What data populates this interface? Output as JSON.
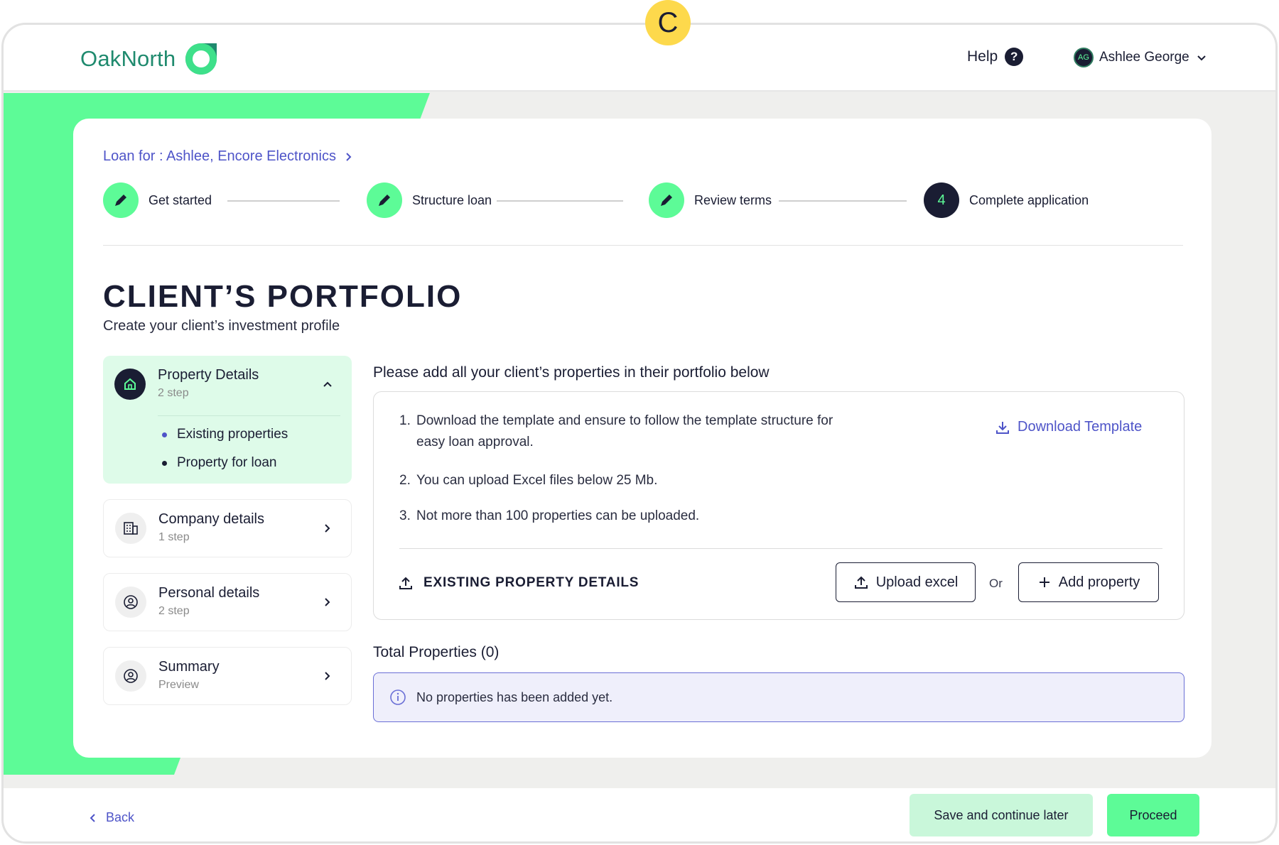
{
  "marker": "C",
  "header": {
    "logo_text": "OakNorth",
    "help_label": "Help",
    "help_badge": "?",
    "user_initials": "AG",
    "user_name": "Ashlee George"
  },
  "breadcrumb": "Loan for : Ashlee, Encore Electronics",
  "steps": [
    {
      "label": "Get started",
      "state": "done"
    },
    {
      "label": "Structure loan",
      "state": "done"
    },
    {
      "label": "Review terms",
      "state": "done"
    },
    {
      "label": "Complete application",
      "state": "active",
      "number": "4"
    }
  ],
  "page": {
    "title": "CLIENT’S PORTFOLIO",
    "subtitle": "Create your client’s investment profile"
  },
  "menu": {
    "property": {
      "title": "Property Details",
      "sub": "2 step",
      "items": [
        "Existing properties",
        "Property for loan"
      ]
    },
    "company": {
      "title": "Company details",
      "sub": "1 step"
    },
    "personal": {
      "title": "Personal details",
      "sub": "2 step"
    },
    "summary": {
      "title": "Summary",
      "sub": "Preview"
    }
  },
  "content": {
    "intro": "Please add all your client’s properties in their portfolio below",
    "instructions": [
      {
        "num": "1.",
        "line1": "Download the template and ensure to follow the template structure for",
        "line2": "easy loan approval."
      },
      {
        "num": "2.",
        "line1": "You can upload  Excel files  below 25 Mb."
      },
      {
        "num": "3.",
        "line1": "Not more than 100 properties can be uploaded."
      }
    ],
    "download_label": "Download Template",
    "existing_label": "EXISTING PROPERTY DETAILS",
    "upload_label": "Upload excel",
    "or_label": "Or",
    "add_label": "Add property",
    "total_label": "Total Properties (0)",
    "empty_message": "No properties has been added yet."
  },
  "footer": {
    "back_label": "Back",
    "save_label": "Save and continue later",
    "proceed_label": "Proceed"
  },
  "colors": {
    "accent_green": "#5dfb97",
    "navy": "#1a1d33",
    "link_purple": "#4e54c8",
    "brand_teal": "#1f8a6e",
    "marker_yellow": "#fdd94c"
  }
}
